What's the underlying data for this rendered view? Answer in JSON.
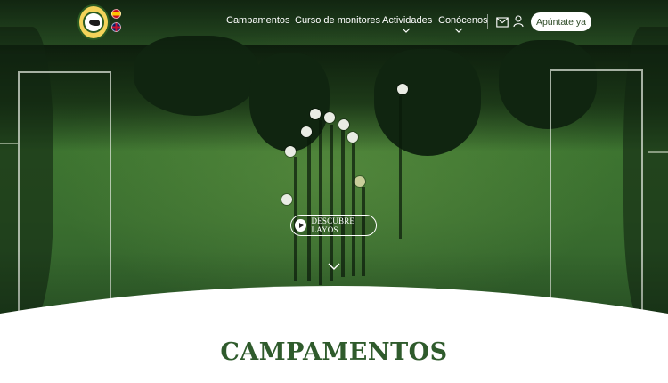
{
  "header": {
    "logo_text": "LAYOS CAMP DESDE 1980",
    "languages": [
      {
        "code": "es",
        "icon": "spain-flag-icon"
      },
      {
        "code": "en",
        "icon": "uk-flag-icon"
      }
    ],
    "nav": [
      {
        "label": "Campamentos",
        "has_dropdown": false
      },
      {
        "label": "Curso de monitores",
        "has_dropdown": false
      },
      {
        "label": "Actividades",
        "has_dropdown": true
      },
      {
        "label": "Conócenos",
        "has_dropdown": true
      }
    ],
    "icons": [
      "mail-icon",
      "user-icon"
    ],
    "cta_label": "Apúntate ya"
  },
  "hero": {
    "discover_label": "DESCUBRE LAYOS",
    "scroll_icon": "chevron-down-icon"
  },
  "section": {
    "title": "CAMPAMENTOS"
  },
  "colors": {
    "brand_green": "#2f5b2c",
    "field_green": "#3d7430",
    "white": "#ffffff"
  }
}
